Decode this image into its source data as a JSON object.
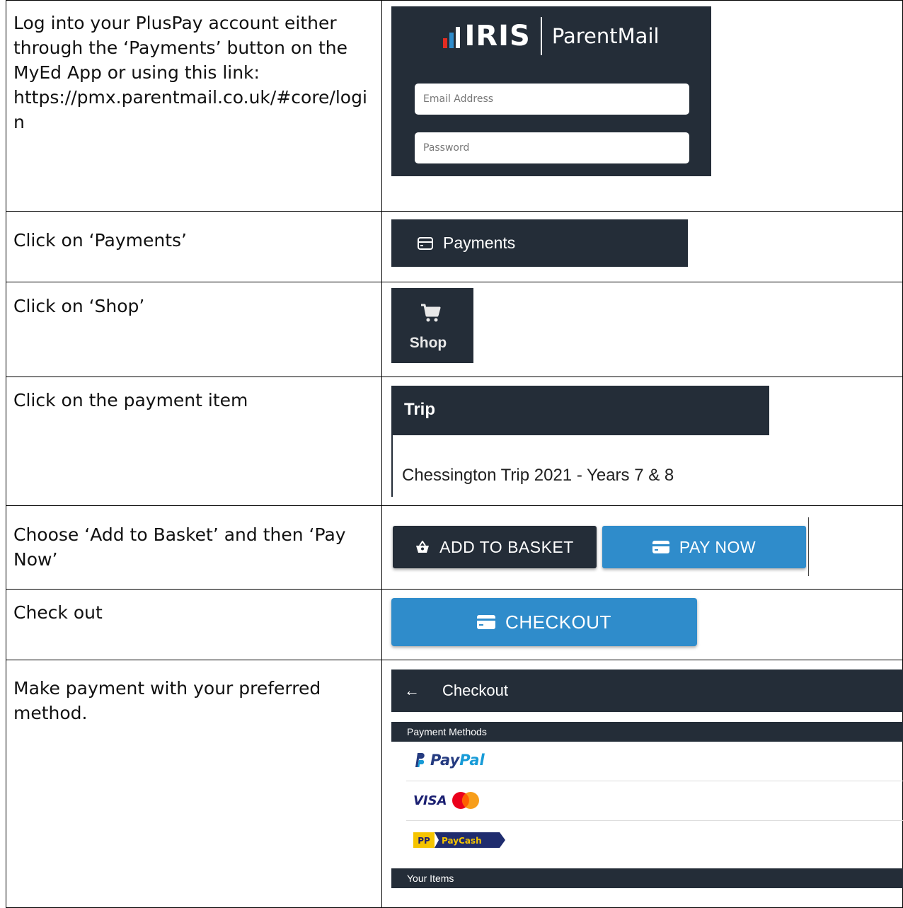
{
  "steps": [
    {
      "text": "Log into your PlusPay account either through the ‘Payments’ button on the MyEd App or using this link: https://pmx.parentmail.co.uk/#core/login"
    },
    {
      "text": "Click on ‘Payments’"
    },
    {
      "text": "Click on ‘Shop’"
    },
    {
      "text": "Click on the payment item"
    },
    {
      "text": "Choose ‘Add to Basket’ and then ‘Pay Now’"
    },
    {
      "text": "Check out"
    },
    {
      "text": "Make payment with your preferred method."
    }
  ],
  "login": {
    "brand": "IRIS",
    "product": "ParentMail",
    "email_placeholder": "Email Address",
    "password_placeholder": "Password"
  },
  "payments": {
    "label": "Payments",
    "icon": "credit-card-icon"
  },
  "shop": {
    "label": "Shop",
    "icon": "shopping-cart-icon"
  },
  "trip": {
    "category": "Trip",
    "item": "Chessington Trip 2021 - Years 7 & 8"
  },
  "buttons": {
    "add_to_basket": "ADD TO BASKET",
    "pay_now": "PAY NOW",
    "checkout": "CHECKOUT"
  },
  "checkout": {
    "title": "Checkout",
    "payment_methods_header": "Payment Methods",
    "your_items_header": "Your Items",
    "methods": [
      {
        "name": "PayPal",
        "icon": "paypal-logo"
      },
      {
        "name": "VISA",
        "icon": "visa-mastercard-logo"
      },
      {
        "name": "PayCash",
        "icon": "paycash-logo"
      }
    ]
  },
  "colors": {
    "dark_panel": "#242d38",
    "primary_blue": "#2f8ccb",
    "iris_bar_red": "#e32c22",
    "iris_bar_blue": "#2f8ccb"
  }
}
